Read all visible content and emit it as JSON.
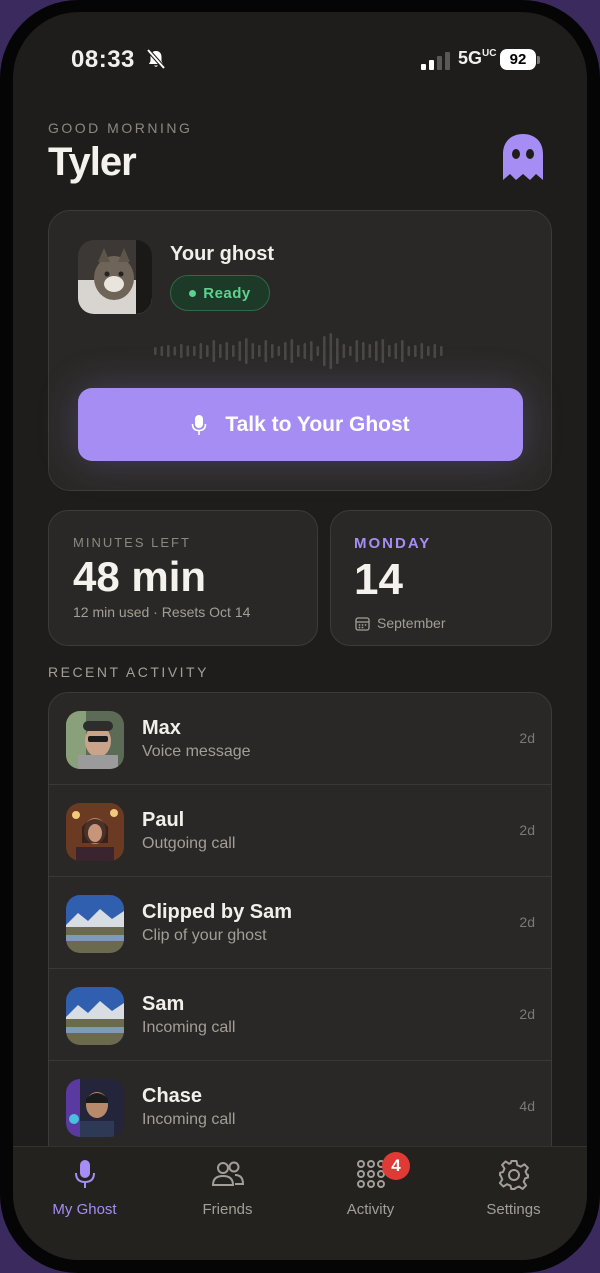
{
  "status_bar": {
    "time": "08:33",
    "network": "5G",
    "network_sup": "UC",
    "battery": "92"
  },
  "header": {
    "greeting": "GOOD MORNING",
    "name": "Tyler",
    "logo_icon": "ghost-icon",
    "accent": "#a58df3"
  },
  "ghost_card": {
    "title": "Your ghost",
    "status": "Ready",
    "status_color": "#5fd18e",
    "talk_button": "Talk to Your Ghost"
  },
  "minutes": {
    "label": "MINUTES LEFT",
    "value": "48 min",
    "subtitle": "12 min used · Resets Oct 14"
  },
  "date": {
    "weekday": "MONDAY",
    "day": "14",
    "month": "September"
  },
  "recent": {
    "title": "RECENT ACTIVITY",
    "items": [
      {
        "name": "Max",
        "detail": "Voice message",
        "time": "2d"
      },
      {
        "name": "Paul",
        "detail": "Outgoing call",
        "time": "2d"
      },
      {
        "name": "Clipped by Sam",
        "detail": "Clip of your ghost",
        "time": "2d"
      },
      {
        "name": "Sam",
        "detail": "Incoming call",
        "time": "2d"
      },
      {
        "name": "Chase",
        "detail": "Incoming call",
        "time": "4d"
      }
    ]
  },
  "tabs": [
    {
      "label": "My Ghost",
      "icon": "mic-icon",
      "active": true
    },
    {
      "label": "Friends",
      "icon": "people-icon",
      "active": false
    },
    {
      "label": "Activity",
      "icon": "grid-dots-icon",
      "active": false,
      "badge": "4"
    },
    {
      "label": "Settings",
      "icon": "gear-icon",
      "active": false
    }
  ]
}
